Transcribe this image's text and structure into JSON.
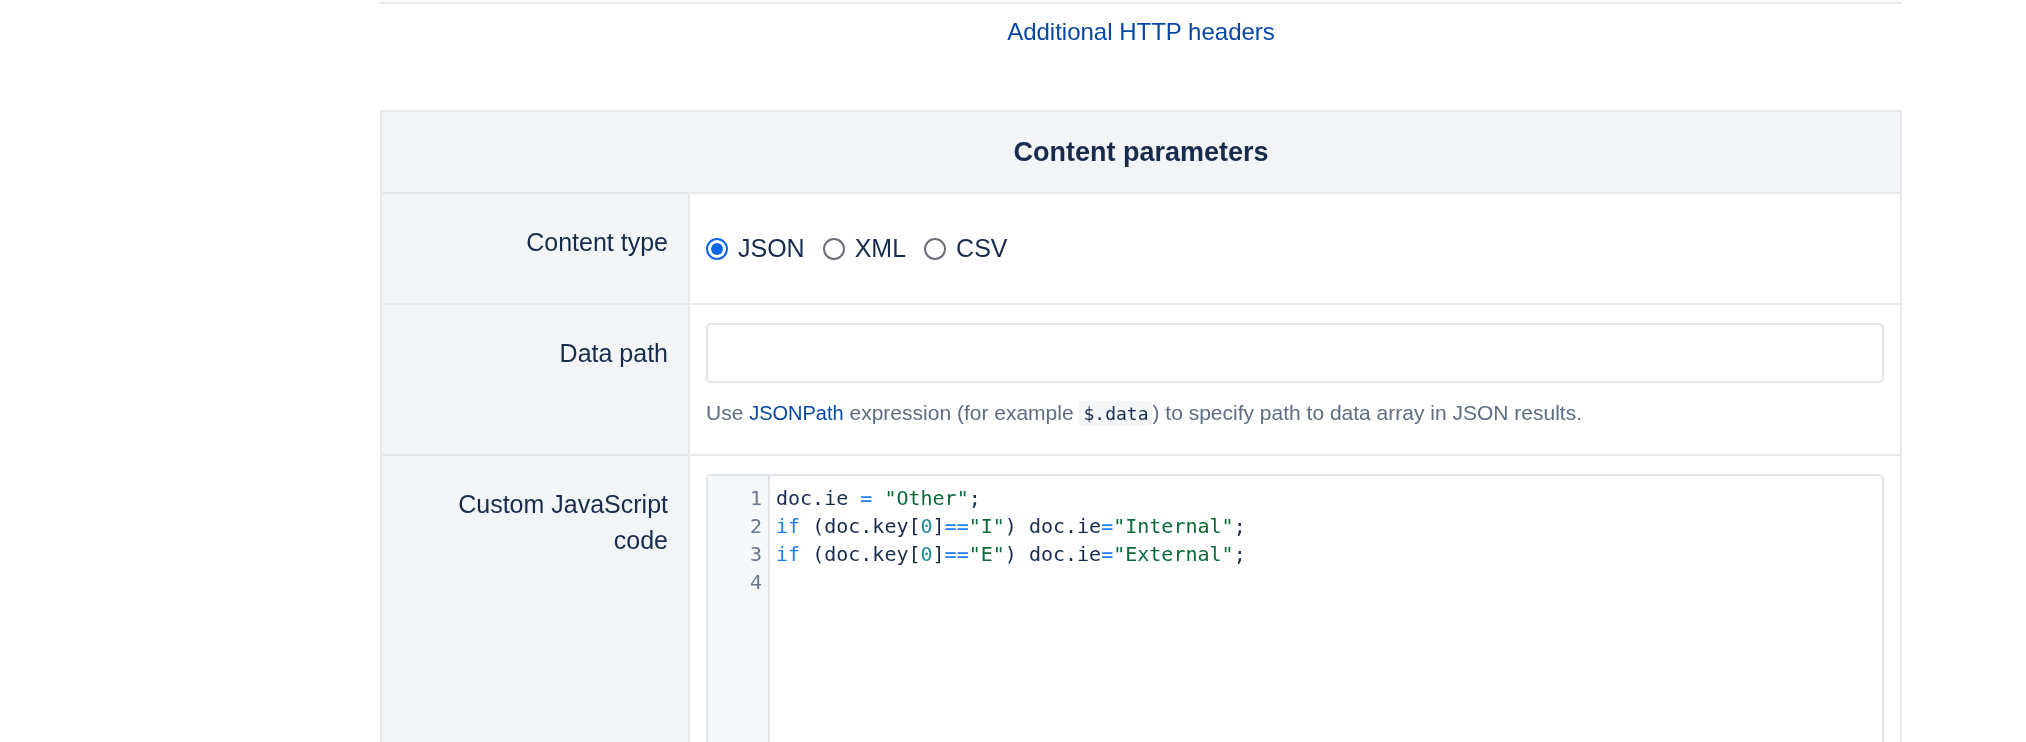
{
  "headers_link": "Additional HTTP headers",
  "section": {
    "title": "Content parameters",
    "content_type": {
      "label": "Content type",
      "options": [
        {
          "label": "JSON",
          "selected": true
        },
        {
          "label": "XML",
          "selected": false
        },
        {
          "label": "CSV",
          "selected": false
        }
      ]
    },
    "data_path": {
      "label": "Data path",
      "help": {
        "before": "Use ",
        "link": "JSONPath",
        "middle": " expression (for example ",
        "code": "$.data",
        "after": ") to specify path to data array in JSON results."
      }
    },
    "custom_code": {
      "label": "Custom JavaScript code",
      "lines": [
        {
          "number": "1",
          "tokens": [
            {
              "kind": "plain",
              "text": "doc.ie "
            },
            {
              "kind": "operator",
              "text": "= "
            },
            {
              "kind": "string",
              "text": "\"Other\""
            },
            {
              "kind": "plain",
              "text": ";"
            }
          ]
        },
        {
          "number": "2",
          "tokens": [
            {
              "kind": "keyword",
              "text": "if"
            },
            {
              "kind": "plain",
              "text": " (doc.key["
            },
            {
              "kind": "number",
              "text": "0"
            },
            {
              "kind": "plain",
              "text": "]"
            },
            {
              "kind": "operator",
              "text": "=="
            },
            {
              "kind": "string",
              "text": "\"I\""
            },
            {
              "kind": "plain",
              "text": ") doc.ie"
            },
            {
              "kind": "operator",
              "text": "="
            },
            {
              "kind": "string",
              "text": "\"Internal\""
            },
            {
              "kind": "plain",
              "text": ";"
            }
          ]
        },
        {
          "number": "3",
          "tokens": [
            {
              "kind": "keyword",
              "text": "if"
            },
            {
              "kind": "plain",
              "text": " (doc.key["
            },
            {
              "kind": "number",
              "text": "0"
            },
            {
              "kind": "plain",
              "text": "]"
            },
            {
              "kind": "operator",
              "text": "=="
            },
            {
              "kind": "string",
              "text": "\"E\""
            },
            {
              "kind": "plain",
              "text": ") doc.ie"
            },
            {
              "kind": "operator",
              "text": "="
            },
            {
              "kind": "string",
              "text": "\"External\""
            },
            {
              "kind": "plain",
              "text": ";"
            }
          ]
        },
        {
          "number": "4"
        }
      ]
    }
  }
}
